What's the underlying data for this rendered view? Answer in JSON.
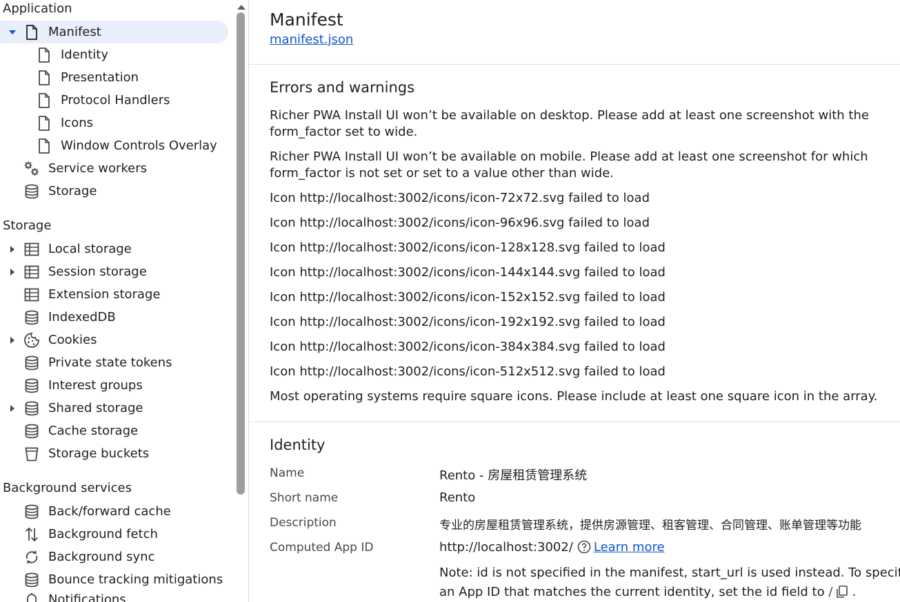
{
  "sidebar": {
    "application": {
      "header": "Application",
      "manifest": "Manifest",
      "children": [
        "Identity",
        "Presentation",
        "Protocol Handlers",
        "Icons",
        "Window Controls Overlay"
      ],
      "service_workers": "Service workers",
      "storage": "Storage"
    },
    "storage": {
      "header": "Storage",
      "items": [
        {
          "label": "Local storage",
          "icon": "table-icon",
          "expandable": true
        },
        {
          "label": "Session storage",
          "icon": "table-icon",
          "expandable": true
        },
        {
          "label": "Extension storage",
          "icon": "table-icon",
          "expandable": false
        },
        {
          "label": "IndexedDB",
          "icon": "database-icon",
          "expandable": false
        },
        {
          "label": "Cookies",
          "icon": "cookie-icon",
          "expandable": true
        },
        {
          "label": "Private state tokens",
          "icon": "database-icon",
          "expandable": false
        },
        {
          "label": "Interest groups",
          "icon": "database-icon",
          "expandable": false
        },
        {
          "label": "Shared storage",
          "icon": "database-icon",
          "expandable": true
        },
        {
          "label": "Cache storage",
          "icon": "database-icon",
          "expandable": false
        },
        {
          "label": "Storage buckets",
          "icon": "bucket-icon",
          "expandable": false
        }
      ]
    },
    "background": {
      "header": "Background services",
      "items": [
        {
          "label": "Back/forward cache",
          "icon": "database-icon"
        },
        {
          "label": "Background fetch",
          "icon": "up-down-arrows-icon"
        },
        {
          "label": "Background sync",
          "icon": "sync-icon"
        },
        {
          "label": "Bounce tracking mitigations",
          "icon": "database-icon"
        },
        {
          "label": "Notifications",
          "icon": "bell-icon"
        }
      ]
    }
  },
  "main": {
    "title": "Manifest",
    "manifest_link": "manifest.json",
    "errors": {
      "title": "Errors and warnings",
      "messages": [
        "Richer PWA Install UI won’t be available on desktop. Please add at least one screenshot with the form_factor set to wide.",
        "Richer PWA Install UI won’t be available on mobile. Please add at least one screenshot for which form_factor is not set or set to a value other than wide.",
        "Icon http://localhost:3002/icons/icon-72x72.svg failed to load",
        "Icon http://localhost:3002/icons/icon-96x96.svg failed to load",
        "Icon http://localhost:3002/icons/icon-128x128.svg failed to load",
        "Icon http://localhost:3002/icons/icon-144x144.svg failed to load",
        "Icon http://localhost:3002/icons/icon-152x152.svg failed to load",
        "Icon http://localhost:3002/icons/icon-192x192.svg failed to load",
        "Icon http://localhost:3002/icons/icon-384x384.svg failed to load",
        "Icon http://localhost:3002/icons/icon-512x512.svg failed to load",
        "Most operating systems require square icons. Please include at least one square icon in the array."
      ]
    },
    "identity": {
      "title": "Identity",
      "name_label": "Name",
      "name_value": "Rento - 房屋租赁管理系统",
      "short_name_label": "Short name",
      "short_name_value": "Rento",
      "description_label": "Description",
      "description_value": "专业的房屋租赁管理系统，提供房源管理、租客管理、合同管理、账单管理等功能",
      "app_id_label": "Computed App ID",
      "app_id_value": "http://localhost:3002/",
      "learn_more": "Learn more",
      "note_line1": "Note: id is not specified in the manifest, start_url is used instead. To specify",
      "note_line2": "an App ID that matches the current identity, set the id field to",
      "note_value": "/",
      "note_end": "."
    }
  },
  "colors": {
    "selected_bg": "#e8eefb",
    "link": "#0b57d0",
    "icon": "#474747",
    "divider": "#d9e2ee",
    "scroll_thumb": "#9e9e9e"
  }
}
